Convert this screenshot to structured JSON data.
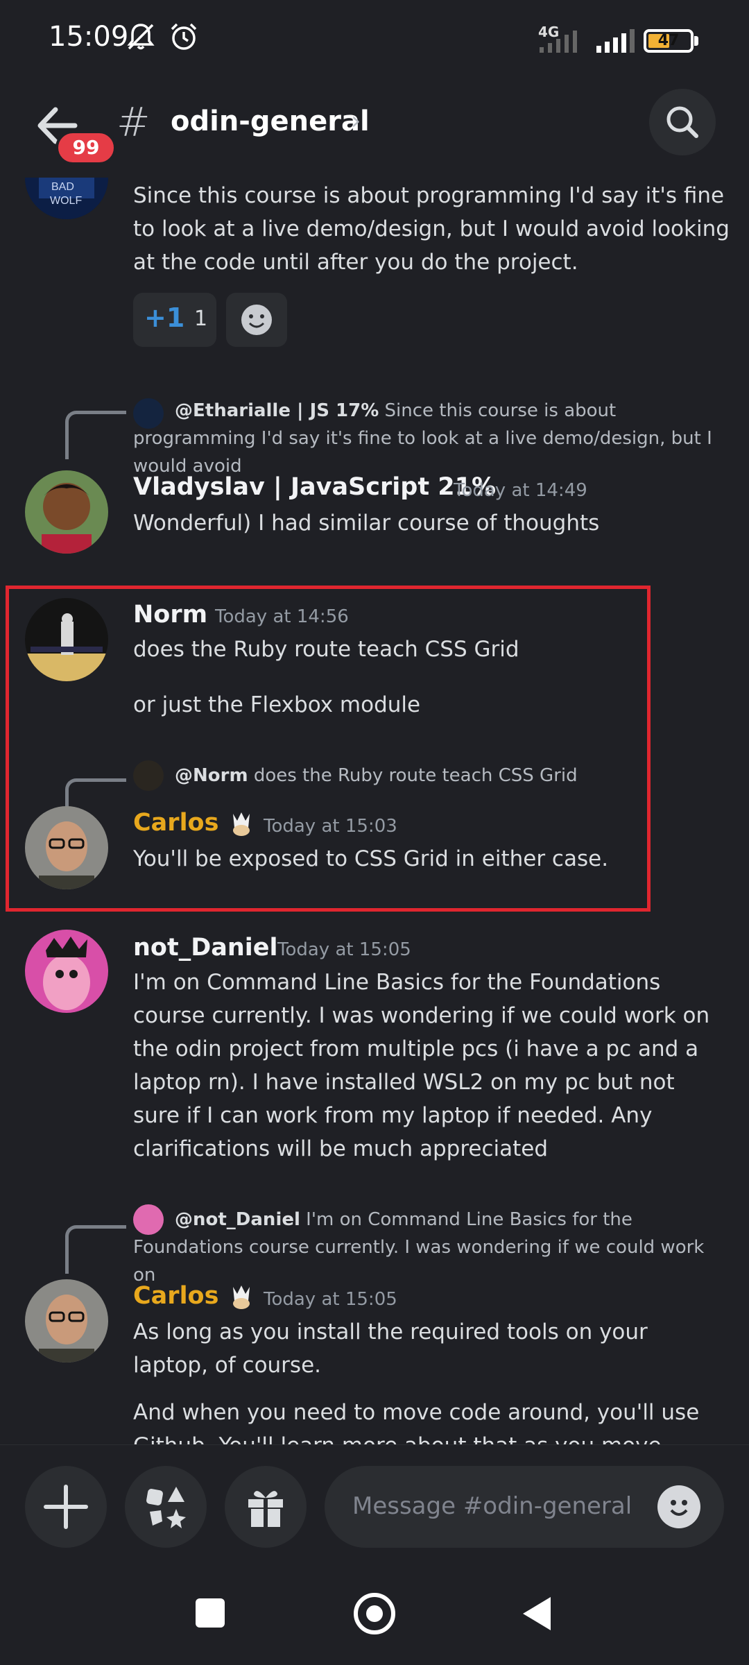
{
  "status_bar": {
    "time": "15:09",
    "network": "4G",
    "battery": "47",
    "icons": [
      "mute-notifications-icon",
      "alarm-icon",
      "signal-icon",
      "battery-icon"
    ]
  },
  "header": {
    "channel": "odin-general",
    "unread_badge": "99",
    "hash": "#",
    "chevron": "›"
  },
  "messages": {
    "m0": {
      "avatar_text": [
        "BAD",
        "WOLF"
      ],
      "text": "Since this course is about programming I'd say it's fine to look at a live demo/design, but I would avoid looking at the code until after you do the project.",
      "reaction_emoji": "+1",
      "reaction_count": "1"
    },
    "m1": {
      "reply_to": "@Etharialle | JS 17%",
      "reply_preview": "Since this course is about programming I'd say it's fine to look at a live demo/design, but I would avoid",
      "author": "Vladyslav | JavaScript 21%",
      "timestamp": "Today at 14:49",
      "text": "Wonderful) I had similar course of thoughts"
    },
    "m2": {
      "author": "Norm",
      "timestamp": "Today at 14:56",
      "text1": "does the Ruby route teach CSS Grid",
      "text2": "or just the Flexbox module"
    },
    "m3": {
      "reply_to": "@Norm",
      "reply_preview": "does the Ruby route teach CSS Grid",
      "author": "Carlos",
      "timestamp": "Today at 15:03",
      "text": "You'll be exposed to CSS Grid in either case."
    },
    "m4": {
      "author": "not_Daniel",
      "timestamp": "Today at 15:05",
      "text": "I'm on Command Line Basics for the Foundations course currently. I was wondering if we could work on the odin project from multiple pcs (i have a pc and a laptop rn). I have installed WSL2 on my pc but not sure if I can work from my laptop if needed. Any clarifications will be much appreciated"
    },
    "m5": {
      "reply_to": "@not_Daniel",
      "reply_preview": "I'm on Command Line Basics for the Foundations course currently. I was wondering if we could work on",
      "author": "Carlos",
      "timestamp": "Today at 15:05",
      "text1": "As long as you install the required tools on your laptop, of course.",
      "text2": "And when you need to move code around, you'll use Github. You'll learn more about that as you move through"
    }
  },
  "composer": {
    "placeholder": "Message #odin-general"
  },
  "colors": {
    "background": "#1f2025",
    "accent_gold": "#e8a81d",
    "badge_red": "#e53c46",
    "highlight_red": "#e0262f"
  }
}
